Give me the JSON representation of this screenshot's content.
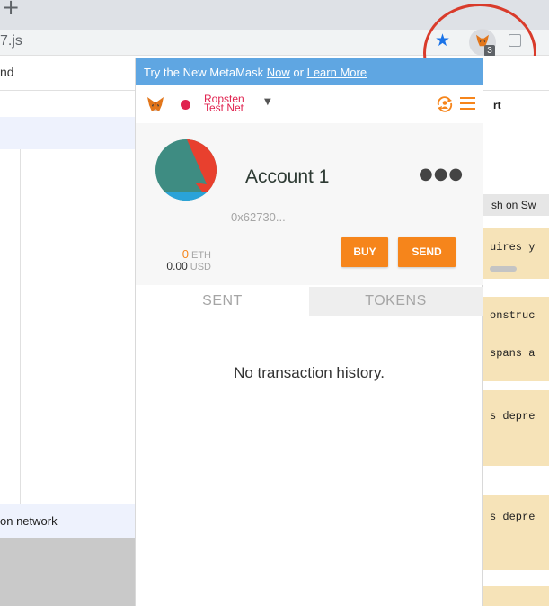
{
  "browser": {
    "url_fragment": "7.js",
    "extension_badge": "3"
  },
  "left_page": {
    "header_text": "nd",
    "network_text": "on network"
  },
  "right_page": {
    "header_text": "rt",
    "switch_text": "sh on Sw",
    "code_lines": [
      "uires y",
      "onstruc",
      "spans a",
      "s depre",
      "s depre"
    ]
  },
  "metamask": {
    "banner": {
      "prefix": "Try the New MetaMask ",
      "link1": "Now",
      "middle": " or ",
      "link2": "Learn More"
    },
    "network": "Ropsten Test Net",
    "account_name": "Account 1",
    "address": "0x62730...",
    "balance_eth": "0",
    "eth_unit": "ETH",
    "balance_usd": "0.00",
    "usd_unit": "USD",
    "buy_label": "BUY",
    "send_label": "SEND",
    "tabs": [
      "SENT",
      "TOKENS"
    ],
    "active_tab": "SENT",
    "empty_message": "No transaction history.",
    "colors": {
      "accent": "#f6851b",
      "banner": "#5fa6e2",
      "network": "#e0234f"
    }
  },
  "icons": [
    "new-tab-icon",
    "bookmark-star-icon",
    "metamask-fox-icon",
    "extension-icon",
    "account-switch-icon",
    "hamburger-menu-icon",
    "more-options-icon",
    "identicon"
  ]
}
